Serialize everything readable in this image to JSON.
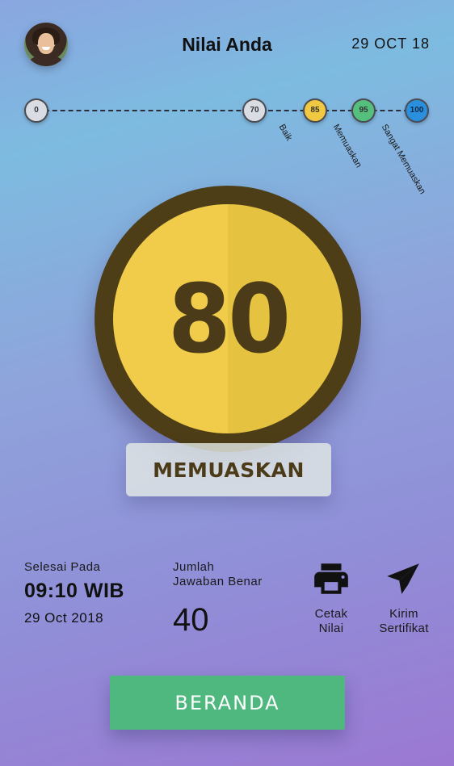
{
  "header": {
    "title": "Nilai Anda",
    "date": "29 OCT 18"
  },
  "scale": {
    "nodes": [
      "0",
      "70",
      "85",
      "95",
      "100"
    ],
    "labels": [
      "Baik",
      "Memuaskan",
      "Sangat Memuaskan"
    ]
  },
  "score": {
    "value": "80",
    "grade": "MEMUASKAN"
  },
  "stats": {
    "finished_label": "Selesai Pada",
    "finished_time": "09:10 WIB",
    "finished_date": "29 Oct 2018",
    "correct_label_line1": "Jumlah",
    "correct_label_line2": "Jawaban Benar",
    "correct_count": "40"
  },
  "actions": {
    "print_line1": "Cetak",
    "print_line2": "Nilai",
    "send_line1": "Kirim",
    "send_line2": "Sertifikat"
  },
  "footer": {
    "home_label": "BERANDA"
  },
  "colors": {
    "score_fill": "#f0cc4a",
    "score_ring": "#4d3e17",
    "node_85": "#f1c842",
    "node_95": "#55c07e",
    "node_100": "#2a8fdc",
    "home_button": "#4fb87f"
  },
  "icons": {
    "print": "printer-icon",
    "send": "paper-plane-icon"
  }
}
